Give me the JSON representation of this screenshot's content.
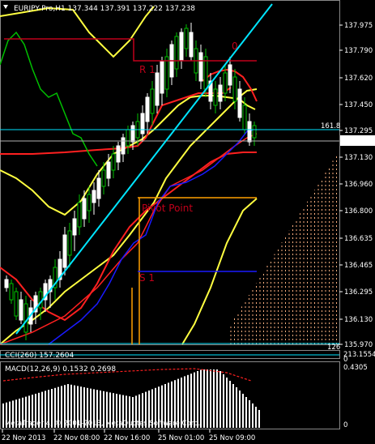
{
  "header": {
    "symbol_line": "EURJPY-Pro,H1  137.344 137.391 137.222 137.238"
  },
  "colors": {
    "background": "#000000",
    "bull": "#00c000",
    "bear": "#ffffff",
    "fib": "#00e5ff",
    "pivot": "#ff9f00",
    "sr": "#c0001a",
    "envelope_yellow": "#ffff40",
    "band_red": "#ff2020",
    "blue": "#1a1aff",
    "green_line": "#00c000",
    "cloud": "#ffb080"
  },
  "price_axis": {
    "ticks": [
      "137.975",
      "137.790",
      "137.620",
      "137.450",
      "137.295",
      "137.130",
      "136.960",
      "136.800",
      "136.635",
      "136.465",
      "136.295",
      "136.130",
      "135.970"
    ],
    "current_price": "137.238",
    "ylim": [
      135.95,
      138.08
    ]
  },
  "levels": {
    "fib_label": "161.8",
    "fib_bottom_label": "126",
    "r1_label": "R 1",
    "pivot_label": "Pivot Point",
    "s1_label": "S 1",
    "marker_label": "0"
  },
  "indicators": {
    "cci_label": "CCI(260) 157.2604",
    "cci_values": "213.1554",
    "cci_zero": "0",
    "macd_label": "MACD(12,26,9) 0.1532 0.2698",
    "macd_max": "0.4305",
    "macd_zero": "0"
  },
  "copyright": "MetaTrader 4, © 2001-2013, MetaQuotes Software Corp.",
  "time_axis": [
    "22 Nov 2013",
    "22 Nov 08:00",
    "22 Nov 16:00",
    "25 Nov 01:00",
    "25 Nov 09:00"
  ]
}
